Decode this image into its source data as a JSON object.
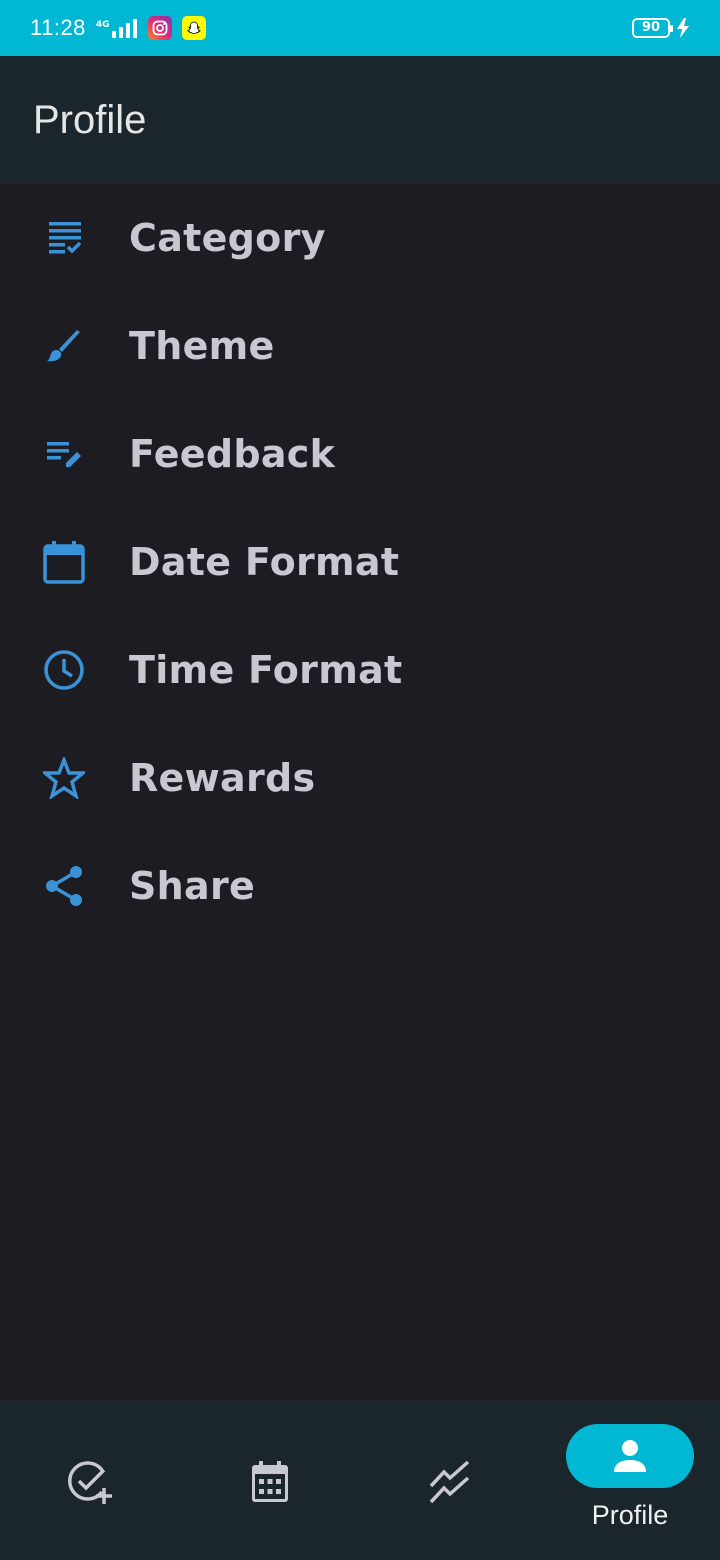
{
  "colors": {
    "accent": "#00b8d4",
    "icon_blue": "#3a93d6",
    "background": "#1c1c22",
    "bar": "#1b262c",
    "text": "#c9c7d1"
  },
  "status_bar": {
    "time": "11:28",
    "network": "4G",
    "battery": "90"
  },
  "app_bar": {
    "title": "Profile"
  },
  "menu": {
    "items": [
      {
        "label": "Category",
        "icon": "category-checklist-icon"
      },
      {
        "label": "Theme",
        "icon": "brush-icon"
      },
      {
        "label": "Feedback",
        "icon": "edit-note-icon"
      },
      {
        "label": "Date Format",
        "icon": "calendar-icon"
      },
      {
        "label": "Time Format",
        "icon": "clock-icon"
      },
      {
        "label": "Rewards",
        "icon": "star-icon"
      },
      {
        "label": "Share",
        "icon": "share-icon"
      }
    ]
  },
  "bottom_nav": {
    "items": [
      {
        "icon": "add-task-icon",
        "active": false
      },
      {
        "icon": "calendar-grid-icon",
        "active": false
      },
      {
        "icon": "stats-icon",
        "active": false
      },
      {
        "icon": "person-icon",
        "active": true,
        "label": "Profile"
      }
    ]
  }
}
